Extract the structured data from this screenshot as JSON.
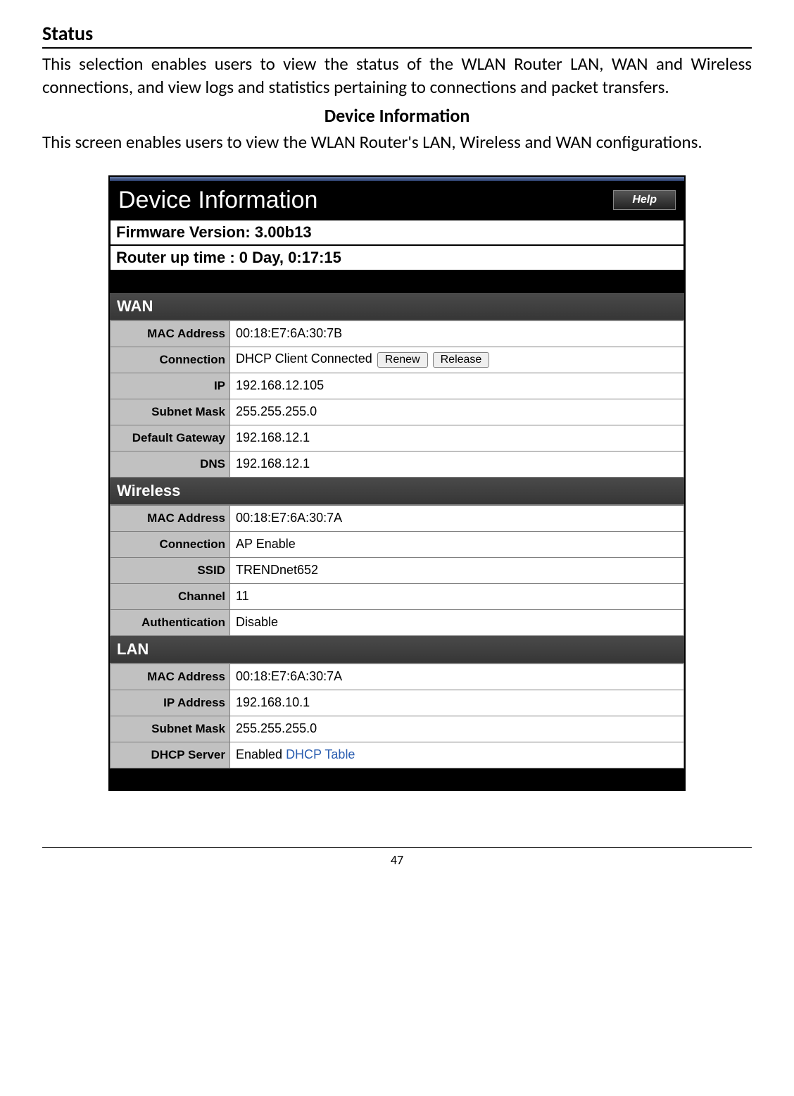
{
  "doc": {
    "heading": "Status",
    "para1": "This selection enables users to view the status of the WLAN Router LAN, WAN and Wireless connections, and view logs and statistics pertaining to connections and packet transfers.",
    "subheading": "Device Information",
    "para2": "This screen enables users to view the WLAN Router's LAN, Wireless and WAN configurations."
  },
  "panel": {
    "title": "Device Information",
    "help_label": "Help",
    "firmware_label": "Firmware Version: 3.00b13",
    "uptime_label": "Router up time :  0 Day, 0:17:15"
  },
  "wan": {
    "section": "WAN",
    "mac_label": "MAC Address",
    "mac_value": "00:18:E7:6A:30:7B",
    "conn_label": "Connection",
    "conn_value": "DHCP Client  Connected",
    "renew_btn": "Renew",
    "release_btn": "Release",
    "ip_label": "IP",
    "ip_value": "192.168.12.105",
    "mask_label": "Subnet Mask",
    "mask_value": "255.255.255.0",
    "gw_label": "Default Gateway",
    "gw_value": "192.168.12.1",
    "dns_label": "DNS",
    "dns_value": "192.168.12.1"
  },
  "wireless": {
    "section": "Wireless",
    "mac_label": "MAC Address",
    "mac_value": "00:18:E7:6A:30:7A",
    "conn_label": "Connection",
    "conn_value": "AP Enable",
    "ssid_label": "SSID",
    "ssid_value": "TRENDnet652",
    "channel_label": "Channel",
    "channel_value": "11",
    "auth_label": "Authentication",
    "auth_value": "Disable"
  },
  "lan": {
    "section": "LAN",
    "mac_label": "MAC Address",
    "mac_value": "00:18:E7:6A:30:7A",
    "ip_label": "IP Address",
    "ip_value": "192.168.10.1",
    "mask_label": "Subnet Mask",
    "mask_value": "255.255.255.0",
    "dhcp_label": "DHCP Server",
    "dhcp_value": "Enabled ",
    "dhcp_link": "DHCP Table"
  },
  "footer": {
    "page": "47"
  }
}
